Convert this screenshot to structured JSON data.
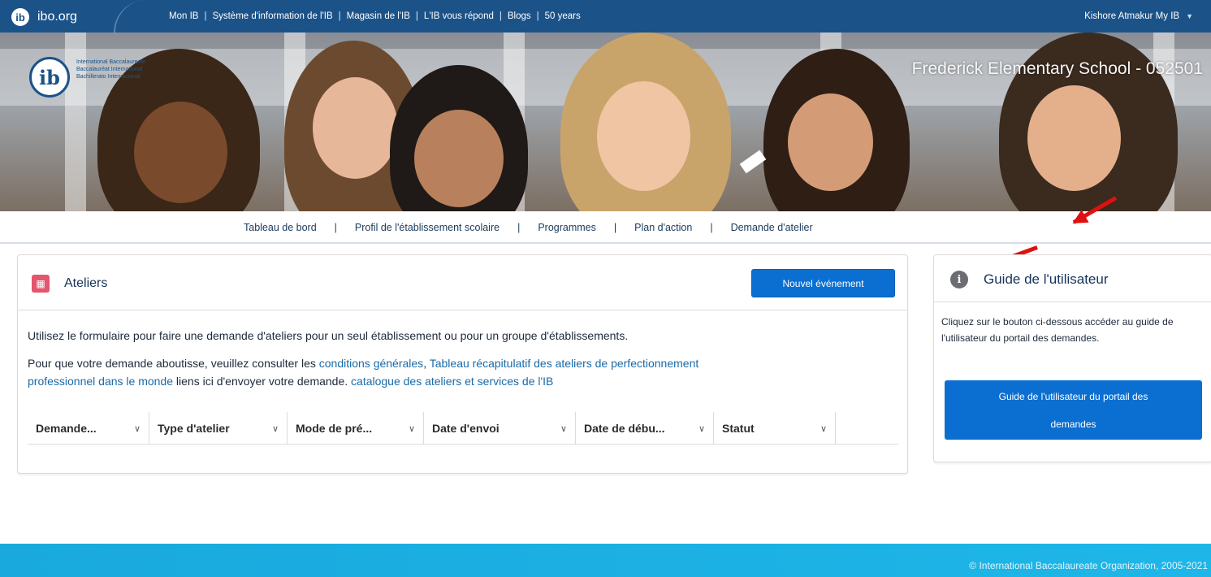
{
  "topbar": {
    "site": "ibo.org",
    "links": [
      "Mon IB",
      "Système d'information de l'IB",
      "Magasin de l'IB",
      "L'IB vous répond",
      "Blogs",
      "50 years"
    ],
    "user": "Kishore Atmakur My IB"
  },
  "hero": {
    "org_lines": [
      "International Baccalaureate",
      "Baccalauréat International",
      "Bachillerato Internacional"
    ],
    "school": "Frederick Elementary School - 052501"
  },
  "subnav": {
    "items": [
      "Tableau de bord",
      "Profil de l'établissement scolaire",
      "Programmes",
      "Plan d'action",
      "Demande d'atelier"
    ]
  },
  "workshops": {
    "title": "Ateliers",
    "new_button": "Nouvel événement",
    "para1": "Utilisez le formulaire pour faire une demande d'ateliers pour un seul établissement ou pour un groupe d'établissements.",
    "para2_prefix": "Pour que votre demande aboutisse, veuillez consulter les ",
    "link_conditions": "conditions générales",
    "link_summary_1": "Tableau récapitulatif des ateliers de perfectionnement",
    "link_summary_2": "professionnel dans le monde",
    "para2_mid": " liens ici d'envoyer votre demande. ",
    "link_catalogue": "catalogue des ateliers et services de l'IB",
    "columns": [
      "Demande...",
      "Type d'atelier",
      "Mode de pré...",
      "Date d'envoi",
      "Date de débu...",
      "Statut"
    ]
  },
  "guide": {
    "title": "Guide de l'utilisateur",
    "text": "Cliquez sur le bouton ci-dessous accéder au guide de l'utilisateur du portail des demandes.",
    "button_line1": "Guide de l'utilisateur du portail des",
    "button_line2": "demandes"
  },
  "footer": {
    "copyright": "© International Baccalaureate Organization, 2005-2021"
  },
  "colors": {
    "topbar": "#1b5288",
    "button": "#0b6fd2",
    "footer": "#1eb6e8",
    "arrow": "#e01010",
    "calendar_icon": "#e3566e"
  },
  "icons": {
    "logo": "ib-logo-icon",
    "workshops": "calendar-icon",
    "guide": "info-icon",
    "user_menu": "chevron-down-icon"
  }
}
